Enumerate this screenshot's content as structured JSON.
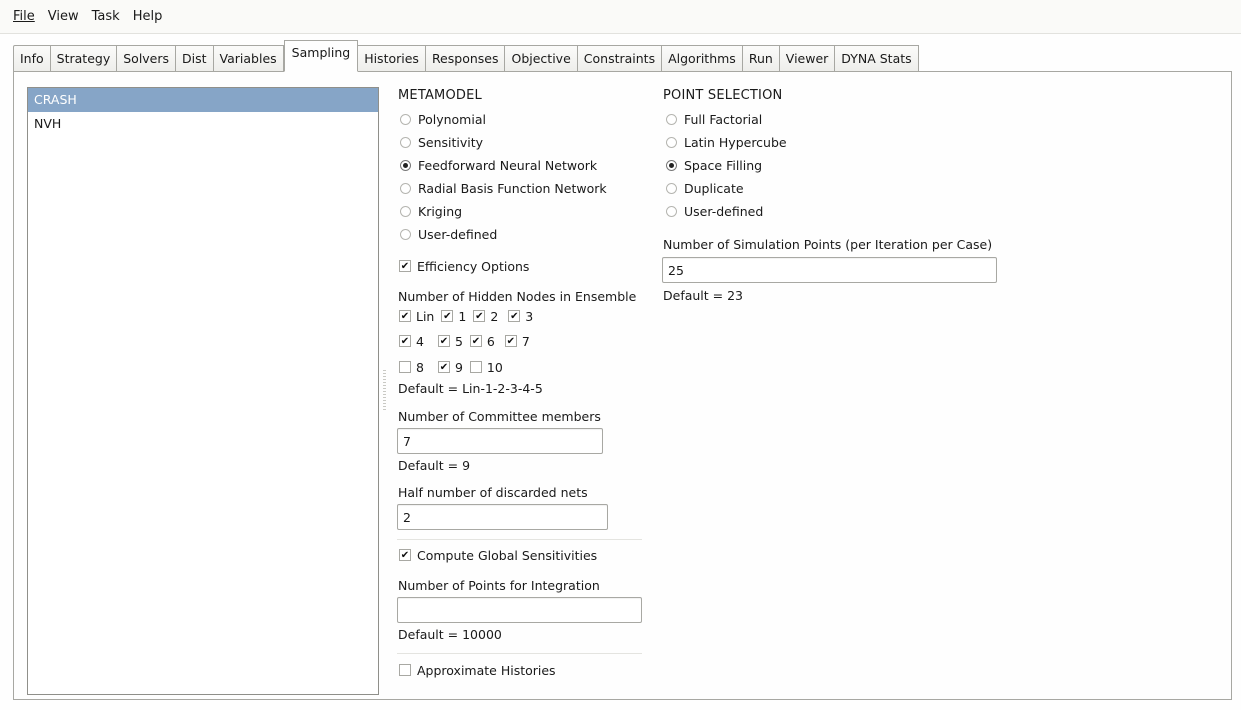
{
  "menu": [
    "File",
    "View",
    "Task",
    "Help"
  ],
  "tabs": [
    "Info",
    "Strategy",
    "Solvers",
    "Dist",
    "Variables",
    "Sampling",
    "Histories",
    "Responses",
    "Objective",
    "Constraints",
    "Algorithms",
    "Run",
    "Viewer",
    "DYNA Stats"
  ],
  "active_tab": "Sampling",
  "cases": [
    "CRASH",
    "NVH"
  ],
  "selected_case": "CRASH",
  "metamodel": {
    "title": "METAMODEL",
    "options": [
      "Polynomial",
      "Sensitivity",
      "Feedforward Neural Network",
      "Radial Basis Function Network",
      "Kriging",
      "User-defined"
    ],
    "selected": "Feedforward Neural Network",
    "efficiency_options": "Efficiency Options",
    "hidden_nodes_label": "Number of Hidden Nodes in Ensemble",
    "hidden_nodes": [
      {
        "label": "Lin",
        "checked": true
      },
      {
        "label": "1",
        "checked": true
      },
      {
        "label": "2",
        "checked": true
      },
      {
        "label": "3",
        "checked": true
      },
      {
        "label": "4",
        "checked": true
      },
      {
        "label": "5",
        "checked": true
      },
      {
        "label": "6",
        "checked": true
      },
      {
        "label": "7",
        "checked": true
      },
      {
        "label": "8",
        "checked": false
      },
      {
        "label": "9",
        "checked": true
      },
      {
        "label": "10",
        "checked": false
      }
    ],
    "hidden_nodes_default": "Default = Lin-1-2-3-4-5",
    "committee_label": "Number of Committee members",
    "committee_value": "7",
    "committee_default": "Default = 9",
    "discarded_label": "Half number of discarded nets",
    "discarded_value": "2",
    "global_sens_label": "Compute Global Sensitivities",
    "integration_label": "Number of Points for Integration",
    "integration_value": "",
    "integration_default": "Default = 10000",
    "approx_histories_label": "Approximate Histories"
  },
  "point_selection": {
    "title": "POINT SELECTION",
    "options": [
      "Full Factorial",
      "Latin Hypercube",
      "Space Filling",
      "Duplicate",
      "User-defined"
    ],
    "selected": "Space Filling",
    "sim_points_label": "Number of Simulation Points (per Iteration per Case)",
    "sim_points_value": "25",
    "sim_points_default": "Default = 23"
  }
}
